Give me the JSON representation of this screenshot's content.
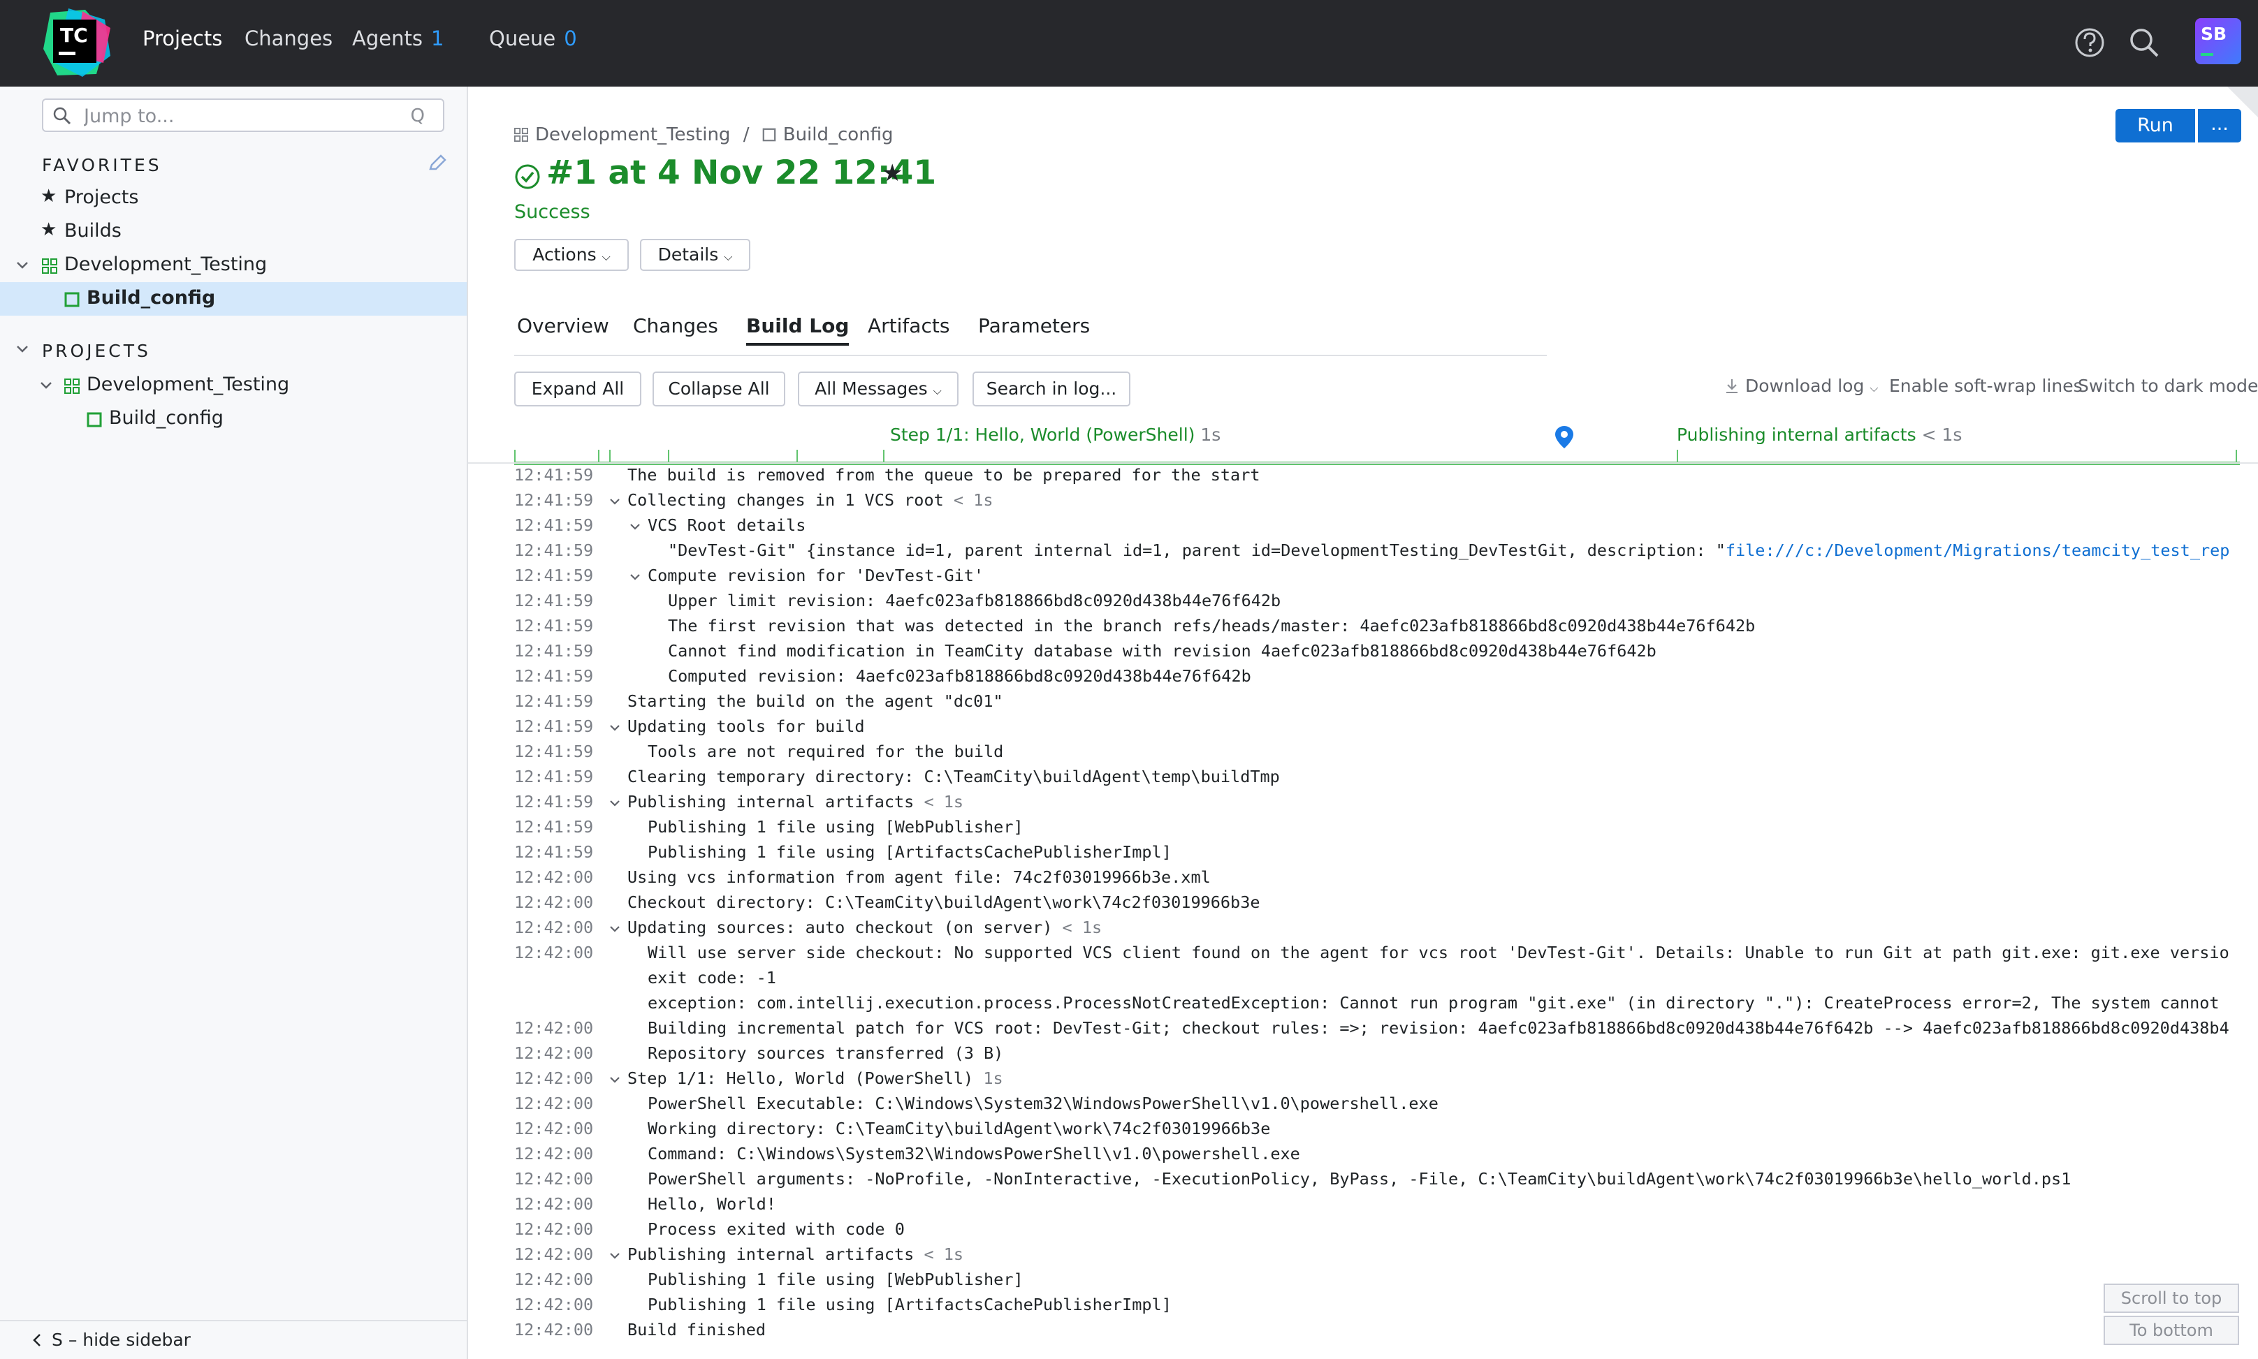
{
  "topbar": {
    "logo_text": "TC",
    "nav": [
      {
        "label": "Projects"
      },
      {
        "label": "Changes"
      },
      {
        "label": "Agents",
        "count": "1"
      },
      {
        "label": "Queue",
        "count": "0"
      }
    ],
    "avatar": "SB"
  },
  "sidebar": {
    "search_placeholder": "Jump to...",
    "search_shortcut": "Q",
    "favorites_head": "FAVORITES",
    "favorites": [
      {
        "label": "Projects"
      },
      {
        "label": "Builds"
      },
      {
        "label": "Development_Testing"
      },
      {
        "label": "Build_config"
      }
    ],
    "projects_head": "PROJECTS",
    "projects": [
      {
        "label": "Development_Testing"
      },
      {
        "label": "Build_config"
      }
    ],
    "hide_label": "S – hide sidebar"
  },
  "build": {
    "breadcrumb_project": "Development_Testing",
    "breadcrumb_sep": "/",
    "breadcrumb_config": "Build_config",
    "title": "#1 at 4 Nov 22 12:41",
    "status": "Success",
    "run_label": "Run",
    "more_label": "...",
    "actions_label": "Actions",
    "details_label": "Details"
  },
  "tabs": [
    {
      "label": "Overview"
    },
    {
      "label": "Changes"
    },
    {
      "label": "Build Log",
      "active": true
    },
    {
      "label": "Artifacts"
    },
    {
      "label": "Parameters"
    }
  ],
  "toolbar": {
    "expand_all": "Expand All",
    "collapse_all": "Collapse All",
    "all_messages": "All Messages",
    "search_log": "Search in log...",
    "download_log": "Download log",
    "soft_wrap": "Enable soft-wrap lines",
    "dark_mode": "Switch to dark mode"
  },
  "timeline": {
    "step_label": "Step 1/1: Hello, World (PowerShell)",
    "step_dur": "1s",
    "publish_label": "Publishing internal artifacts",
    "publish_dur": "< 1s"
  },
  "log": [
    {
      "time": "12:41:59",
      "indent": 0,
      "text": "The build is removed from the queue to be prepared for the start"
    },
    {
      "time": "12:41:59",
      "indent": 0,
      "toggle": true,
      "text": "Collecting changes in 1 VCS root",
      "dur": "< 1s"
    },
    {
      "time": "12:41:59",
      "indent": 1,
      "toggle": true,
      "text": "VCS Root details"
    },
    {
      "time": "12:41:59",
      "indent": 2,
      "text": "\"DevTest-Git\" {instance id=1, parent internal id=1, parent id=DevelopmentTesting_DevTestGit, description: \"",
      "link": "file:///c:/Development/Migrations/teamcity_test_rep"
    },
    {
      "time": "12:41:59",
      "indent": 1,
      "toggle": true,
      "text": "Compute revision for 'DevTest-Git'"
    },
    {
      "time": "12:41:59",
      "indent": 2,
      "text": "Upper limit revision: 4aefc023afb818866bd8c0920d438b44e76f642b"
    },
    {
      "time": "12:41:59",
      "indent": 2,
      "text": "The first revision that was detected in the branch refs/heads/master: 4aefc023afb818866bd8c0920d438b44e76f642b"
    },
    {
      "time": "12:41:59",
      "indent": 2,
      "text": "Cannot find modification in TeamCity database with revision 4aefc023afb818866bd8c0920d438b44e76f642b"
    },
    {
      "time": "12:41:59",
      "indent": 2,
      "text": "Computed revision: 4aefc023afb818866bd8c0920d438b44e76f642b"
    },
    {
      "time": "12:41:59",
      "indent": 0,
      "text": "Starting the build on the agent \"dc01\""
    },
    {
      "time": "12:41:59",
      "indent": 0,
      "toggle": true,
      "text": "Updating tools for build"
    },
    {
      "time": "12:41:59",
      "indent": 1,
      "text": "Tools are not required for the build"
    },
    {
      "time": "12:41:59",
      "indent": 0,
      "text": "Clearing temporary directory: C:\\TeamCity\\buildAgent\\temp\\buildTmp"
    },
    {
      "time": "12:41:59",
      "indent": 0,
      "toggle": true,
      "text": "Publishing internal artifacts",
      "dur": "< 1s"
    },
    {
      "time": "12:41:59",
      "indent": 1,
      "text": "Publishing 1 file using [WebPublisher]"
    },
    {
      "time": "12:41:59",
      "indent": 1,
      "text": "Publishing 1 file using [ArtifactsCachePublisherImpl]"
    },
    {
      "time": "12:42:00",
      "indent": 0,
      "text": "Using vcs information from agent file: 74c2f03019966b3e.xml"
    },
    {
      "time": "12:42:00",
      "indent": 0,
      "text": "Checkout directory: C:\\TeamCity\\buildAgent\\work\\74c2f03019966b3e"
    },
    {
      "time": "12:42:00",
      "indent": 0,
      "toggle": true,
      "text": "Updating sources: auto checkout (on server)",
      "dur": "< 1s"
    },
    {
      "time": "12:42:00",
      "indent": 1,
      "text": "Will use server side checkout: No supported VCS client found on the agent for vcs root 'DevTest-Git'. Details: Unable to run Git at path git.exe: git.exe versio"
    },
    {
      "time": "",
      "indent": 1,
      "text": "exit code: -1"
    },
    {
      "time": "",
      "indent": 1,
      "text": "exception: com.intellij.execution.process.ProcessNotCreatedException: Cannot run program \"git.exe\" (in directory \".\"): CreateProcess error=2, The system cannot"
    },
    {
      "time": "12:42:00",
      "indent": 1,
      "text": "Building incremental patch for VCS root: DevTest-Git; checkout rules: =>; revision: 4aefc023afb818866bd8c0920d438b44e76f642b --> 4aefc023afb818866bd8c0920d438b4"
    },
    {
      "time": "12:42:00",
      "indent": 1,
      "text": "Repository sources transferred (3 B)"
    },
    {
      "time": "12:42:00",
      "indent": 0,
      "toggle": true,
      "text": "Step 1/1: Hello, World (PowerShell)",
      "dur": "1s"
    },
    {
      "time": "12:42:00",
      "indent": 1,
      "text": "PowerShell Executable: C:\\Windows\\System32\\WindowsPowerShell\\v1.0\\powershell.exe"
    },
    {
      "time": "12:42:00",
      "indent": 1,
      "text": "Working directory: C:\\TeamCity\\buildAgent\\work\\74c2f03019966b3e"
    },
    {
      "time": "12:42:00",
      "indent": 1,
      "text": "Command: C:\\Windows\\System32\\WindowsPowerShell\\v1.0\\powershell.exe"
    },
    {
      "time": "12:42:00",
      "indent": 1,
      "text": "PowerShell arguments: -NoProfile, -NonInteractive, -ExecutionPolicy, ByPass, -File, C:\\TeamCity\\buildAgent\\work\\74c2f03019966b3e\\hello_world.ps1"
    },
    {
      "time": "12:42:00",
      "indent": 1,
      "text": "Hello, World!"
    },
    {
      "time": "12:42:00",
      "indent": 1,
      "text": "Process exited with code 0"
    },
    {
      "time": "12:42:00",
      "indent": 0,
      "toggle": true,
      "text": "Publishing internal artifacts",
      "dur": "< 1s"
    },
    {
      "time": "12:42:00",
      "indent": 1,
      "text": "Publishing 1 file using [WebPublisher]"
    },
    {
      "time": "12:42:00",
      "indent": 1,
      "text": "Publishing 1 file using [ArtifactsCachePublisherImpl]"
    },
    {
      "time": "12:42:00",
      "indent": 0,
      "text": "Build finished"
    }
  ],
  "scroll": {
    "top_label": "Scroll to top",
    "bottom_label": "To bottom"
  },
  "colors": {
    "success": "#1b8c2b",
    "accent": "#0f6fd2",
    "topbar": "#27282c"
  }
}
